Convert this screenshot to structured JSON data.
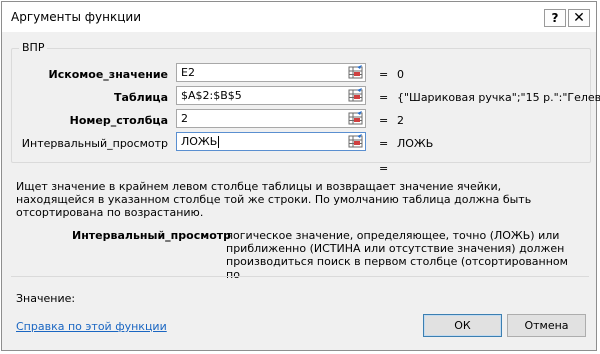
{
  "dialog": {
    "title": "Аргументы функции",
    "help_label": "?",
    "close_label": "✕"
  },
  "function_name": "ВПР",
  "args": [
    {
      "name": "Искомое_значение",
      "value": "E2",
      "eq": "=",
      "result": "0"
    },
    {
      "name": "Таблица",
      "value": "$A$2:$B$5",
      "eq": "=",
      "result": "{\"Шариковая ручка\";\"15 р.\":\"Гелев"
    },
    {
      "name": "Номер_столбца",
      "value": "2",
      "eq": "=",
      "result": "2"
    },
    {
      "name": "Интервальный_просмотр",
      "value": "ЛОЖЬ",
      "eq": "=",
      "result": "ЛОЖЬ"
    }
  ],
  "formula_eq": "=",
  "description": "Ищет значение в крайнем левом столбце таблицы и возвращает значение ячейки, находящейся в указанном столбце той же строки. По умолчанию таблица должна быть отсортирована по возрастанию.",
  "arg_description": {
    "name": "Интервальный_просмотр",
    "text": "логическое значение, определяющее, точно (ЛОЖЬ) или приближенно (ИСТИНА или отсутствие значения) должен производиться поиск в первом столбце (отсортированном по"
  },
  "value_label": "Значение:",
  "help_link": "Справка по этой функции",
  "buttons": {
    "ok": "ОК",
    "cancel": "Отмена"
  },
  "icons": {
    "ref": "range-selector-icon"
  }
}
